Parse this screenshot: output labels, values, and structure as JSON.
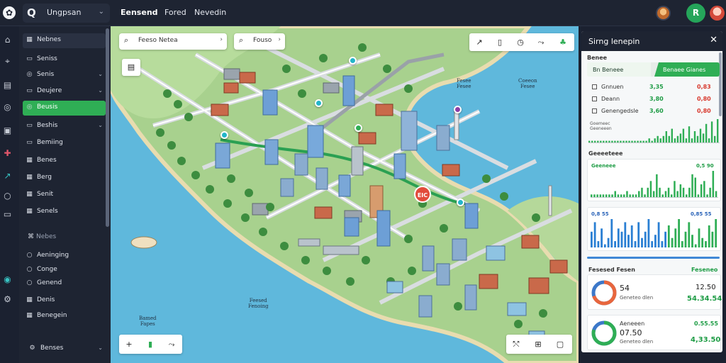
{
  "topbar": {
    "workspace_icon": "Q",
    "workspace_name": "Ungpsan",
    "nav": [
      "Eensend",
      "Fored",
      "Nevedin"
    ],
    "avatar_button_letter": "R"
  },
  "rail_icons": [
    "home-icon",
    "location-icon",
    "map-icon",
    "layers-icon",
    "target-icon",
    "globe-icon",
    "share-icon",
    "user-icon",
    "grid-icon",
    "world-icon",
    "settings-icon"
  ],
  "sidebar": {
    "items": [
      {
        "label": "Nebnes",
        "icon": "grid-icon",
        "type": "header"
      },
      {
        "label": "Seniss",
        "icon": "map-icon",
        "type": "normal"
      },
      {
        "label": "Senis",
        "icon": "target-icon",
        "type": "normal",
        "chevron": true
      },
      {
        "label": "Deujere",
        "icon": "layers-icon",
        "type": "normal",
        "chevron": true
      },
      {
        "label": "Beusis",
        "icon": "target-icon",
        "type": "active"
      },
      {
        "label": "Beshis",
        "icon": "folder-icon",
        "type": "normal",
        "chevron": true
      },
      {
        "label": "Bemiing",
        "icon": "list-icon",
        "type": "normal"
      },
      {
        "label": "Benes",
        "icon": "grid-icon",
        "type": "normal"
      },
      {
        "label": "Berg",
        "icon": "grid-icon",
        "type": "normal"
      },
      {
        "label": "Senit",
        "icon": "grid-icon",
        "type": "normal"
      },
      {
        "label": "Senels",
        "icon": "grid-icon",
        "type": "normal"
      }
    ],
    "section_label": "Nebes",
    "section_items": [
      {
        "label": "Aeninging",
        "icon": "circle-icon"
      },
      {
        "label": "Conge",
        "icon": "circle-icon"
      },
      {
        "label": "Genend",
        "icon": "circle-icon"
      },
      {
        "label": "Denis",
        "icon": "grid-icon"
      },
      {
        "label": "Benegein",
        "icon": "grid-icon"
      }
    ],
    "footer_label": "Benses"
  },
  "map": {
    "search_main": "Feeso Netea",
    "search_secondary": "Fouso",
    "label_1": "Feesed\nFenoing",
    "label_2": "Bamed\nFapes",
    "label_3": "Fesee\nFesee",
    "label_4": "Coeeon\nFesee",
    "poi_badge": "EIC",
    "tools_top": [
      "route-icon",
      "phone-icon",
      "clock-icon",
      "route-icon",
      "share-icon"
    ],
    "tools_bottom_left": [
      "plus-icon",
      "marker-icon",
      "route-icon"
    ],
    "tools_bottom_right": [
      "route-icon",
      "grid-icon",
      "window-icon"
    ]
  },
  "panel": {
    "title": "Sirng lenepin",
    "subtitle": "Benee",
    "tab_a": "Bn Beneee",
    "tab_b": "Benaee Gianes",
    "rows": [
      {
        "label": "Gnnuen",
        "green": "3,35",
        "red": "0,83"
      },
      {
        "label": "Deann",
        "green": "3,80",
        "red": "0,80"
      },
      {
        "label": "Genengedsle",
        "green": "3,60",
        "red": "0,80"
      }
    ],
    "chart1_caption": "Goemeec\nGeeneeen",
    "section2": "Geeeeteee",
    "chart2_label_left": "Geeneee",
    "chart2_label_right": "0,5 90",
    "chart3_label_left": "0,8 55",
    "chart3_label_right": "0,85 55",
    "section3_left": "Fesesed Fesen",
    "section3_right": "Feseneo",
    "ring1_value": "54",
    "ring1_sub": "Geneteo dlen",
    "ring1_right_top": "12.50",
    "ring1_right_bottom": "54.34.54",
    "ring2_title": "Aeneeen",
    "ring2_value": "07.50",
    "ring2_sub": "Geneteo dlen",
    "ring2_right_top": "0.55.55",
    "ring2_right_bottom": "4,33.50",
    "chart1_values": [
      1,
      1,
      1,
      1,
      1,
      1,
      1,
      1,
      1,
      1,
      1,
      1,
      1,
      1,
      1,
      1,
      1,
      1,
      1,
      1,
      1,
      2,
      1,
      2,
      3,
      2,
      3,
      5,
      3,
      6,
      2,
      3,
      4,
      6,
      2,
      7,
      2,
      5,
      3,
      6,
      4,
      8,
      2,
      9,
      3,
      10
    ],
    "chart2_values": [
      1,
      1,
      1,
      1,
      1,
      1,
      1,
      1,
      2,
      1,
      1,
      1,
      2,
      1,
      1,
      1,
      2,
      3,
      1,
      3,
      5,
      2,
      7,
      3,
      1,
      2,
      3,
      1,
      5,
      2,
      4,
      3,
      1,
      3,
      7,
      6,
      1,
      4,
      5,
      1,
      3,
      8,
      2
    ],
    "chart3_values": [
      5,
      8,
      2,
      6,
      1,
      3,
      9,
      2,
      6,
      5,
      8,
      4,
      7,
      2,
      8,
      3,
      5,
      9,
      2,
      4,
      8,
      2,
      5,
      7,
      3,
      6,
      9,
      2,
      5,
      8,
      4,
      1,
      6,
      3,
      2,
      7,
      5,
      9
    ],
    "ring1_share": 0.7,
    "ring2_share": 0.8
  }
}
